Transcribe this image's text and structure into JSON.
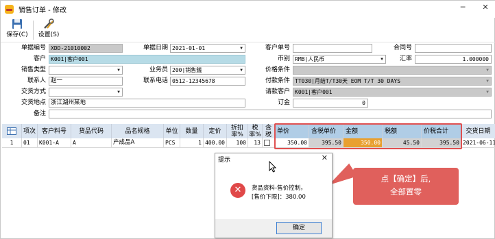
{
  "window": {
    "title": "销售订单 - 修改",
    "minimize": "─",
    "close": "✕"
  },
  "toolbar": {
    "save_label": "保存(C)",
    "settings_label": "设置(S)",
    "save_icon": "floppy-disk-icon",
    "settings_icon": "tools-icon"
  },
  "form": {
    "order_no_label": "单据编号",
    "order_no": "XDD-21010002",
    "order_date_label": "单据日期",
    "order_date": "2021-01-01",
    "customer_no_label": "客户单号",
    "customer_no": "",
    "contract_no_label": "合同号",
    "contract_no": "",
    "customer_label": "客户",
    "customer": "K001|客户001",
    "currency_label": "币别",
    "currency": "RMB|人民币",
    "exchange_label": "汇率",
    "exchange": "1.000000",
    "sales_type_label": "销售类型",
    "sales_type": "",
    "salesman_label": "业务员",
    "salesman": "200|销售銭",
    "price_cond_label": "价格条件",
    "price_cond": "",
    "contact_label": "联系人",
    "contact": "赵一",
    "phone_label": "联系电话",
    "phone": "0512-12345678",
    "payment_label": "付款条件",
    "payment": "TT030|月结T/T30天 EOM T/T 30 DAYS",
    "delivery_method_label": "交货方式",
    "delivery_method": "",
    "payer_label": "请款客户",
    "payer": "K001|客户001",
    "delivery_place_label": "交货地点",
    "delivery_place": "浙江湖州某地",
    "deposit_label": "订金",
    "deposit": "0",
    "remark_label": "备注",
    "remark": ""
  },
  "grid": {
    "headers": [
      "项次",
      "客户料号",
      "货品代码",
      "品名规格",
      "单位",
      "数量",
      "定价",
      "折扣率%",
      "税率%",
      "含税",
      "单价",
      "含税单价",
      "金额",
      "税额",
      "价税合计",
      "交货日期"
    ],
    "row": {
      "idx": "1",
      "item_no": "01",
      "cust_part": "K001-A",
      "goods_code": "A",
      "name_spec": "产成品A",
      "unit": "PCS",
      "qty": "1",
      "list_price": "400.00",
      "discount": "100",
      "tax_rate": "13",
      "tax_incl": "",
      "unit_price": "350.00",
      "tax_unit_price": "395.50",
      "amount": "350.00",
      "tax_amount": "45.50",
      "total": "395.50",
      "delivery_date": "2021-06-11"
    }
  },
  "dialog": {
    "title": "提示",
    "close": "✕",
    "message_line1": "货品资料-售价控制，",
    "message_line2": "[售价下限]：380.00",
    "ok_label": "确定",
    "error_icon": "error-icon"
  },
  "callout": {
    "line1": "点【确定】后,",
    "line2": "全部置零"
  },
  "colors": {
    "highlight_box": "#e05050",
    "callout_bg": "#e0605c",
    "amount_cell": "#e8a030",
    "customer_field": "#b6dbe6"
  }
}
